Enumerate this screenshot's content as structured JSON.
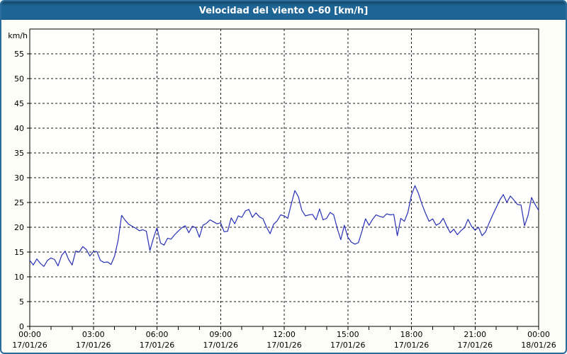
{
  "window": {
    "title": "Velocidad del viento 0-60 [km/h]"
  },
  "colors": {
    "titlebar": "#1e6494",
    "titlebar_top_edge": "#124865",
    "window_border": "#2b6c9b",
    "background": "#fbfdf6",
    "plot_background": "#fffffd",
    "grid": "#1a1a1a",
    "axis": "#000000",
    "text": "#000000",
    "line": "#2730b5"
  },
  "chart_data": {
    "type": "line",
    "title": "Velocidad del viento 0-60 [km/h]",
    "xlabel": "",
    "ylabel": "km/h",
    "ylim": [
      0,
      60
    ],
    "yticks": [
      0,
      5,
      10,
      15,
      20,
      25,
      30,
      35,
      40,
      45,
      50,
      55
    ],
    "x_hours_span": 24,
    "x_major_tick_hours": 3,
    "x_minor_tick_hours": 1,
    "grid": "dashed",
    "legend_position": "none",
    "x_major_labels": [
      {
        "time": "00:00",
        "date": "17/01/26"
      },
      {
        "time": "03:00",
        "date": "17/01/26"
      },
      {
        "time": "06:00",
        "date": "17/01/26"
      },
      {
        "time": "09:00",
        "date": "17/01/26"
      },
      {
        "time": "12:00",
        "date": "17/01/26"
      },
      {
        "time": "15:00",
        "date": "17/01/26"
      },
      {
        "time": "18:00",
        "date": "17/01/26"
      },
      {
        "time": "21:00",
        "date": "17/01/26"
      },
      {
        "time": "00:00",
        "date": "18/01/26"
      }
    ],
    "series": [
      {
        "name": "Velocidad del viento",
        "unit": "km/h",
        "color": "#2730b5",
        "interval_minutes": 10,
        "values": [
          13.3,
          12.4,
          13.6,
          12.7,
          12.1,
          13.3,
          13.8,
          13.5,
          12.2,
          14.3,
          15.2,
          13.5,
          12.4,
          15.2,
          15.0,
          16.1,
          15.5,
          14.2,
          15.1,
          15.1,
          13.3,
          12.9,
          13.0,
          12.5,
          14.2,
          17.4,
          22.4,
          21.4,
          20.6,
          20.2,
          19.8,
          19.3,
          19.5,
          19.2,
          15.3,
          17.8,
          19.9,
          16.8,
          16.4,
          17.8,
          17.6,
          18.5,
          19.2,
          19.9,
          20.3,
          18.9,
          20.2,
          19.9,
          18.0,
          20.4,
          20.8,
          21.5,
          21.1,
          20.7,
          20.9,
          19.1,
          19.2,
          21.9,
          20.7,
          22.3,
          22.0,
          23.3,
          23.6,
          22.0,
          22.9,
          22.1,
          21.7,
          20.0,
          18.7,
          20.6,
          21.3,
          22.5,
          22.3,
          21.8,
          24.7,
          27.4,
          26.2,
          23.4,
          22.3,
          22.5,
          22.6,
          21.5,
          23.7,
          21.5,
          21.8,
          23.0,
          22.5,
          19.8,
          17.5,
          20.4,
          18.0,
          17.0,
          16.6,
          16.9,
          19.2,
          21.7,
          20.4,
          21.6,
          22.5,
          22.2,
          22.0,
          22.7,
          22.5,
          22.6,
          18.3,
          21.8,
          21.2,
          23.0,
          26.5,
          28.4,
          26.8,
          24.6,
          22.8,
          21.2,
          21.7,
          20.4,
          20.8,
          21.8,
          20.2,
          18.9,
          19.6,
          18.5,
          19.3,
          19.9,
          21.6,
          20.2,
          19.4,
          20.0,
          18.3,
          19.1,
          20.9,
          22.5,
          24.0,
          25.5,
          26.6,
          25.0,
          26.3,
          25.5,
          24.6,
          24.5,
          20.3,
          22.4,
          26.0,
          24.6,
          23.4
        ]
      }
    ]
  }
}
